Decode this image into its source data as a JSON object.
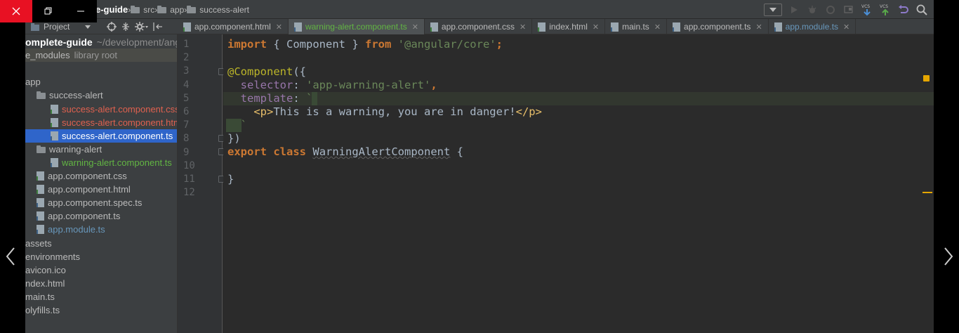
{
  "breadcrumbs": [
    "e-guide",
    "src",
    "app",
    "success-alert"
  ],
  "project_panel": {
    "title": "Project",
    "tree": [
      {
        "label": "omplete-guide",
        "suffix": "~/development/ang",
        "kind": "root",
        "indent": 0
      },
      {
        "label": "e_modules",
        "suffix": "library root",
        "kind": "libroot",
        "indent": 0
      },
      {
        "label": "",
        "kind": "blank",
        "indent": 0
      },
      {
        "label": "app",
        "kind": "folder-partial",
        "indent": 0
      },
      {
        "label": "success-alert",
        "kind": "folder",
        "indent": 1
      },
      {
        "label": "success-alert.component.css",
        "kind": "css-red",
        "indent": 2
      },
      {
        "label": "success-alert.component.html",
        "kind": "html-red",
        "indent": 2
      },
      {
        "label": "success-alert.component.ts",
        "kind": "ts-selected",
        "indent": 2
      },
      {
        "label": "warning-alert",
        "kind": "folder",
        "indent": 1
      },
      {
        "label": "warning-alert.component.ts",
        "kind": "ts-green",
        "indent": 2
      },
      {
        "label": "app.component.css",
        "kind": "css",
        "indent": 1
      },
      {
        "label": "app.component.html",
        "kind": "html",
        "indent": 1
      },
      {
        "label": "app.component.spec.ts",
        "kind": "ts",
        "indent": 1
      },
      {
        "label": "app.component.ts",
        "kind": "ts",
        "indent": 1
      },
      {
        "label": "app.module.ts",
        "kind": "ts-blue",
        "indent": 1
      },
      {
        "label": "assets",
        "kind": "plain",
        "indent": 0
      },
      {
        "label": "environments",
        "kind": "plain",
        "indent": 0
      },
      {
        "label": "avicon.ico",
        "kind": "plain",
        "indent": 0
      },
      {
        "label": "ndex.html",
        "kind": "plain",
        "indent": 0
      },
      {
        "label": "main.ts",
        "kind": "plain",
        "indent": 0
      },
      {
        "label": "olyfills.ts",
        "kind": "plain",
        "indent": 0
      }
    ]
  },
  "tabs": [
    {
      "label": "app.component.html",
      "type": "html",
      "state": "normal"
    },
    {
      "label": "warning-alert.component.ts",
      "type": "ts",
      "state": "active"
    },
    {
      "label": "app.component.css",
      "type": "css",
      "state": "normal"
    },
    {
      "label": "index.html",
      "type": "html",
      "state": "normal"
    },
    {
      "label": "main.ts",
      "type": "ts",
      "state": "normal"
    },
    {
      "label": "app.component.ts",
      "type": "ts",
      "state": "normal"
    },
    {
      "label": "app.module.ts",
      "type": "ts",
      "state": "module"
    }
  ],
  "tab_close": "✕",
  "line_numbers": [
    "1",
    "2",
    "3",
    "4",
    "5",
    "6",
    "7",
    "8",
    "9",
    "10",
    "11",
    "12"
  ],
  "code": {
    "l1_kw": "import",
    "l1_mid": " { Component } ",
    "l1_from": "from",
    "l1_str": "'@angular/core'",
    "l1_end": ";",
    "l3": "@Component",
    "l3_end": "({",
    "l4_prop": "  selector",
    "l4_colon": ": ",
    "l4_str": "'app-warning-alert'",
    "l4_end": ",",
    "l5_prop": "  template",
    "l5_colon": ": ",
    "l5_tick": "`",
    "l6_pre": "    ",
    "l6_open": "<p>",
    "l6_text": "This is a warning, you are in danger!",
    "l6_close": "</p>",
    "l7_tick": "  `",
    "l8": "})",
    "l9_kw1": "export",
    "l9_kw2": "class",
    "l9_cls": "WarningAlertComponent",
    "l9_end": " {",
    "l11": "}"
  },
  "colors": {
    "keyword": "#cc7832",
    "string": "#6a8759",
    "annotation": "#bbb529",
    "property": "#9876aa",
    "tag": "#e8bf6a",
    "text": "#a9b7c6",
    "selection": "#2f65ca",
    "close_button": "#e81123"
  },
  "icons": [
    "close-icon",
    "restore-icon",
    "minimize-icon",
    "folder-icon",
    "vcs-update-icon",
    "vcs-commit-icon",
    "undo-icon",
    "search-icon",
    "prev-arrow-icon",
    "next-arrow-icon"
  ]
}
